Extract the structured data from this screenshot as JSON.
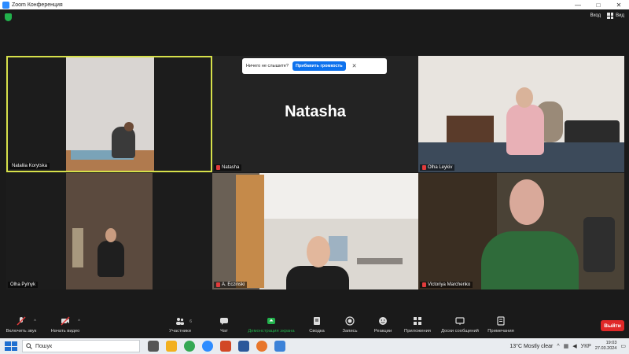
{
  "window": {
    "title": "Zoom Конференция",
    "controls": [
      "—",
      "□",
      "✕"
    ]
  },
  "top_bar": {
    "enter_label": "Вход",
    "view_label": "Вид"
  },
  "audio_notice": {
    "text": "Ничего не слышите?",
    "button": "Прибавить громкость",
    "close": "✕"
  },
  "participants": [
    {
      "name": "Nataliia Korytska",
      "muted": false,
      "active_speaker": true
    },
    {
      "name": "Natasha",
      "muted": true,
      "video_off": true
    },
    {
      "name": "Olha Leykiv",
      "muted": true
    },
    {
      "name": "Olha Pylnyk",
      "muted": false
    },
    {
      "name": "A. Eczinski",
      "muted": true
    },
    {
      "name": "Victoriya Marchenko",
      "muted": true
    }
  ],
  "toolbar": {
    "unmute": "Включить звук",
    "start_video": "Начать видео",
    "participants": "Участники",
    "participants_count": "6",
    "chat": "Чат",
    "share_screen": "Демонстрация экрана",
    "summary": "Сводка",
    "record": "Запись",
    "reactions": "Реакции",
    "apps": "Приложения",
    "whiteboards": "Доски сообщений",
    "notes": "Примечания",
    "leave": "Выйти"
  },
  "taskbar": {
    "search_placeholder": "Пошук",
    "weather": "13°C  Mostly clear",
    "language": "УКР",
    "time": "19:03",
    "date": "27.03.2024"
  },
  "colors": {
    "active_speaker_border": "#d6e04a",
    "share_green": "#22b14c",
    "leave_red": "#e02828",
    "notice_button_blue": "#0e72ed"
  }
}
